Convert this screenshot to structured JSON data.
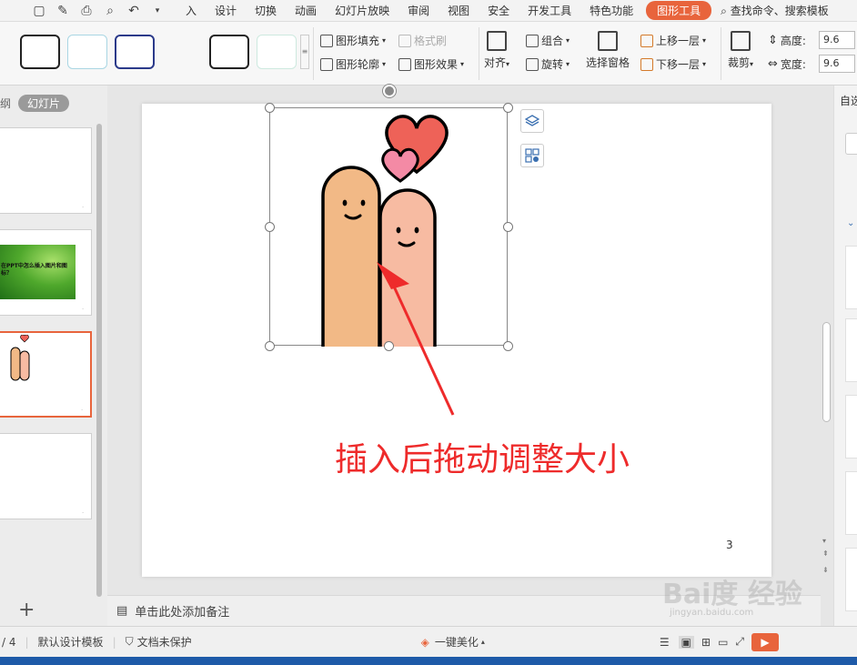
{
  "quick_access": {
    "icons": [
      "save-icon",
      "format-painter-icon",
      "print-icon",
      "print-preview-icon",
      "undo-icon"
    ]
  },
  "menu": {
    "items": [
      "入",
      "设计",
      "切换",
      "动画",
      "幻灯片放映",
      "审阅",
      "视图",
      "安全",
      "开发工具",
      "特色功能"
    ],
    "active": "图形工具",
    "search": "查找命令、搜索模板"
  },
  "ribbon": {
    "fill": "图形填充",
    "format_brush": "格式刷",
    "outline": "图形轮廓",
    "effects": "图形效果",
    "group": "组合",
    "rotate": "旋转",
    "align": "对齐",
    "select_pane": "选择窗格",
    "bring_forward": "上移一层",
    "send_backward": "下移一层",
    "crop": "裁剪",
    "height_label": "高度:",
    "width_label": "宽度:",
    "height_value": "9.6",
    "width_value": "9.6"
  },
  "left_panel": {
    "outline_tab": "纲",
    "slides_tab": "幻灯片",
    "thumb2_text": "在PPT中怎么插入图片和图标？"
  },
  "slide": {
    "caption": "插入后拖动调整大小",
    "page_number": "3"
  },
  "right_panel": {
    "label": "自选"
  },
  "notes": {
    "placeholder": "单击此处添加备注"
  },
  "status": {
    "page": "/ 4",
    "template": "默认设计模板",
    "protect": "文档未保护",
    "beautify": "一键美化"
  },
  "watermark": {
    "text": "Bai度 经验",
    "sub": "jingyan.baidu.com"
  },
  "colors": {
    "accent": "#e8643c",
    "caption": "#ee2b2b",
    "finger_left": "#f2b986",
    "finger_right": "#f7bba2",
    "heart_big": "#ee6258",
    "heart_small": "#f48aa5"
  }
}
